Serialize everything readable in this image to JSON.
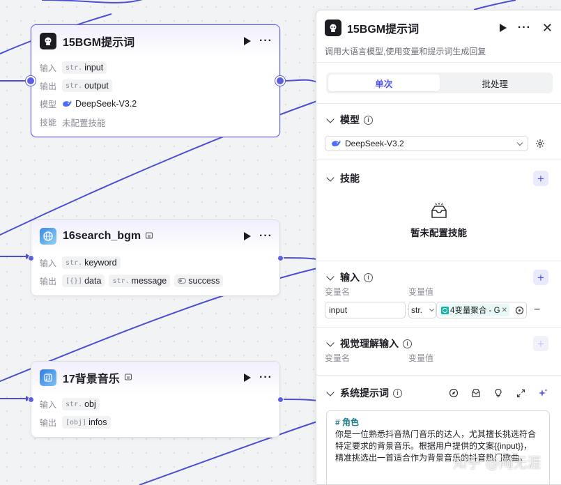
{
  "colors": {
    "accent": "#5b5fe0",
    "primary": "#4d53e8",
    "edge": "#4b4fd1"
  },
  "nodes": [
    {
      "title": "15BGM提示词",
      "icon": "llm-robot-icon",
      "input_label": "输入",
      "input_type": "str.",
      "input_value": "input",
      "output_label": "输出",
      "output_type": "str.",
      "output_value": "output",
      "model_label": "模型",
      "model_value": "DeepSeek-V3.2",
      "skill_label": "技能",
      "skill_value": "未配置技能"
    },
    {
      "title": "16search_bgm",
      "icon": "plugin-globe-icon",
      "input_label": "输入",
      "input_type": "str.",
      "input_value": "keyword",
      "output_label": "输出",
      "outputs": [
        {
          "type": "[{}]",
          "value": "data"
        },
        {
          "type": "str.",
          "value": "message"
        },
        {
          "type": "toggle",
          "value": "success"
        }
      ]
    },
    {
      "title": "17背景音乐",
      "icon": "plugin-music-icon",
      "input_label": "输入",
      "input_type": "str.",
      "input_value": "obj",
      "output_label": "输出",
      "output_type": "[obj]",
      "output_value": "infos"
    }
  ],
  "panel": {
    "title": "15BGM提示词",
    "description": "调用大语言模型,使用变量和提示词生成回复",
    "tabs": [
      "单次",
      "批处理"
    ],
    "model": {
      "label": "模型",
      "value": "DeepSeek-V3.2"
    },
    "skills": {
      "label": "技能",
      "empty": "暂未配置技能"
    },
    "input": {
      "label": "输入",
      "col_name": "变量名",
      "col_value": "变量值",
      "var_name": "input",
      "var_type": "str.",
      "var_ref": "4变量聚合 - G"
    },
    "vision": {
      "label": "视觉理解输入",
      "col_name": "变量名",
      "col_value": "变量值"
    },
    "system_prompt": {
      "label": "系统提示词",
      "heading": "# 角色",
      "lines": [
        "你是一位熟悉抖音热门音乐的达人，尤其擅长挑选符合",
        "特定要求的背景音乐。根据用户提供的文案{{input}}，",
        "精准挑选出一首适合作为背景音乐的抖音热门歌曲。"
      ]
    }
  },
  "watermark": "知乎 @陶无涯"
}
